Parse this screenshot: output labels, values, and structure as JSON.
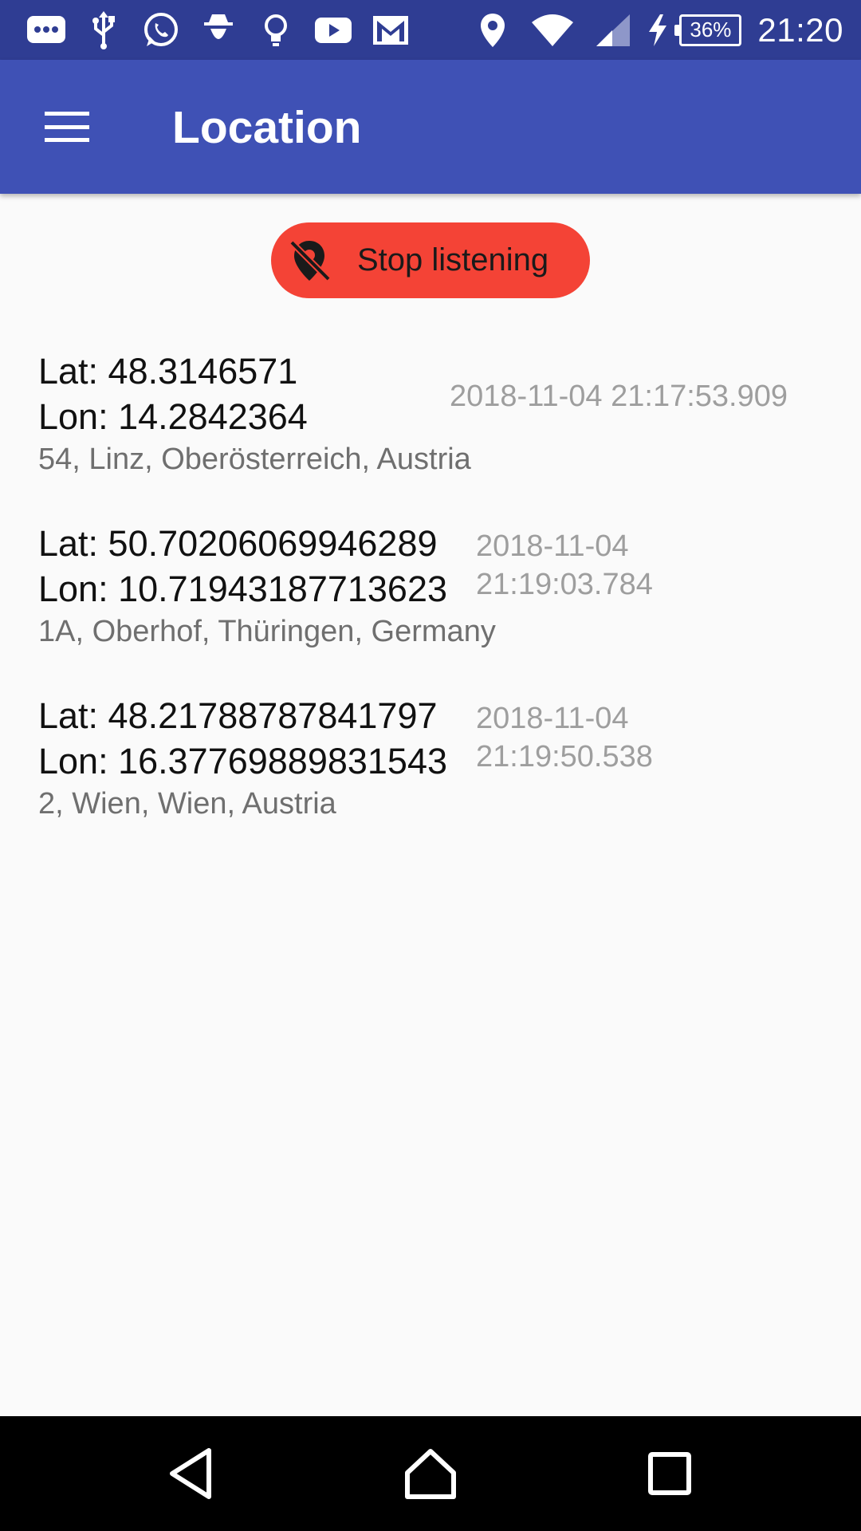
{
  "status_bar": {
    "time": "21:20",
    "battery_percent": "36%",
    "icons_left": [
      "message-icon",
      "usb-icon",
      "whatsapp-icon",
      "incognito-icon",
      "lightbulb-icon",
      "youtube-icon",
      "gmail-icon"
    ],
    "icons_right": [
      "location-pin-icon",
      "wifi-icon",
      "cell-signal-icon",
      "charging-icon",
      "battery-icon"
    ]
  },
  "app_bar": {
    "title": "Location",
    "menu_icon": "hamburger-menu-icon"
  },
  "action_button": {
    "label": "Stop listening",
    "icon": "location-off-icon",
    "color": "#f44336"
  },
  "entries": [
    {
      "lat": "Lat: 48.3146571",
      "lon": "Lon: 14.2842364",
      "address": "54, Linz, Oberösterreich, Austria",
      "timestamp": "2018-11-04 21:17:53.909"
    },
    {
      "lat": "Lat: 50.70206069946289",
      "lon": "Lon: 10.71943187713623",
      "address": "1A, Oberhof, Thüringen, Germany",
      "timestamp_date": "2018-11-04",
      "timestamp_time": "21:19:03.784"
    },
    {
      "lat": "Lat: 48.21788787841797",
      "lon": "Lon: 16.37769889831543",
      "address": "2, Wien, Wien, Austria",
      "timestamp_date": "2018-11-04",
      "timestamp_time": "21:19:50.538"
    }
  ],
  "nav_bar": {
    "buttons": [
      "back-icon",
      "home-icon",
      "recents-icon"
    ]
  },
  "colors": {
    "status_bar": "#2f3d93",
    "app_bar": "#3f51b5",
    "background": "#fafafa",
    "nav_bar": "#000000"
  }
}
